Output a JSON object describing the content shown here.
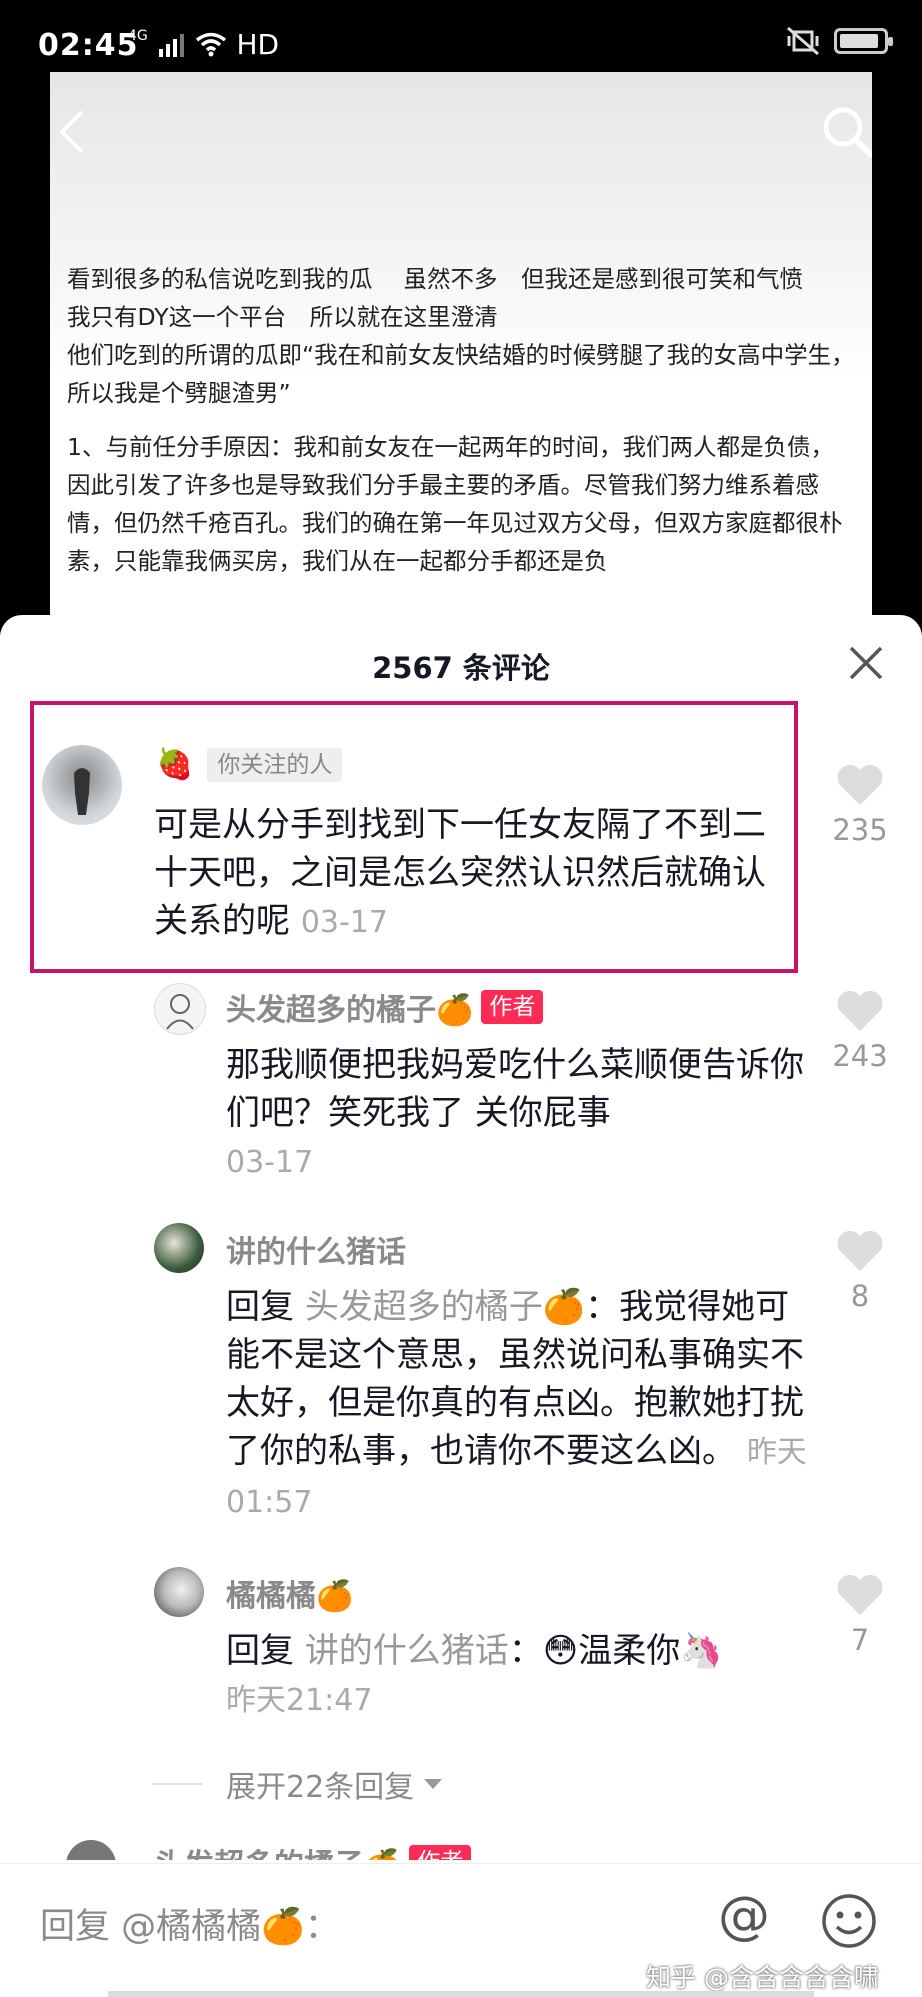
{
  "status": {
    "time": "02:45",
    "network": "4G",
    "hd": "HD"
  },
  "article": {
    "paragraphs": [
      "看到很多的私信说吃到我的瓜　 虽然不多　但我还是感到很可笑和气愤",
      "我只有DY这一个平台　所以就在这里澄清",
      "他们吃到的所谓的瓜即“我在和前女友快结婚的时候劈腿了我的女高中学生，所以我是个劈腿渣男”",
      "1、与前任分手原因：我和前女友在一起两年的时间，我们两人都是负债，因此引发了许多也是导致我们分手最主要的矛盾。尽管我们努力维系着感情，但仍然千疮百孔。我们的确在第一年见过双方父母，但双方家庭都很朴素，只能靠我俩买房，我们从在一起都分手都还是负"
    ]
  },
  "sheet": {
    "title": "2567 条评论"
  },
  "comments": [
    {
      "tag": "你关注的人",
      "text": "可是从分手到找到下一任女友隔了不到二十天吧，之间是怎么突然认识然后就确认关系的呢",
      "time": "03-17",
      "likes": "235"
    },
    {
      "name": "头发超多的橘子🍊",
      "badge": "作者",
      "text": "那我顺便把我妈爱吃什么菜顺便告诉你们吧？笑死我了 关你屁事",
      "time": "03-17",
      "likes": "243"
    },
    {
      "name": "讲的什么猪话",
      "reply_prefix": "回复",
      "reply_to": "头发超多的橘子🍊",
      "text": "：我觉得她可能不是这个意思，虽然说问私事确实不太好，但是你真的有点凶。抱歉她打扰了你的私事，也请你不要这么凶。",
      "time": "昨天01:57",
      "likes": "8"
    },
    {
      "name": "橘橘橘🍊",
      "reply_prefix": "回复",
      "reply_to": "讲的什么猪话",
      "text": "：😳温柔你🦄",
      "time": "昨天21:47",
      "likes": "7"
    }
  ],
  "expand_label": "展开22条回复",
  "next_peek": {
    "name": "头发超多的橘子🍊",
    "badge": "作者"
  },
  "bottom": {
    "placeholder": "回复 @橘橘橘🍊：",
    "at": "@"
  },
  "watermark": "知乎 @含含含含含啸",
  "colors": {
    "accent": "#fe2c55",
    "highlight": "#c8136a"
  }
}
